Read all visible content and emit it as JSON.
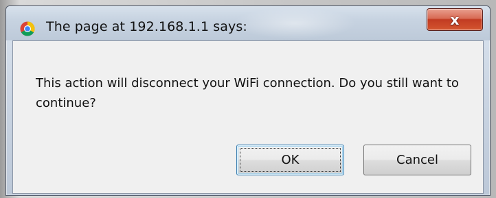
{
  "dialog": {
    "title": "The page at 192.168.1.1 says:",
    "close_label": "x",
    "message": "This action will disconnect your WiFi connection. Do you still want to continue?",
    "ok_label": "OK",
    "cancel_label": "Cancel",
    "app_icon": "chrome-icon"
  },
  "colors": {
    "close_button": "#c9452b",
    "default_button_border": "#3c7fb1",
    "client_background": "#f0f0f0",
    "titlebar": "#c8d3e1"
  }
}
